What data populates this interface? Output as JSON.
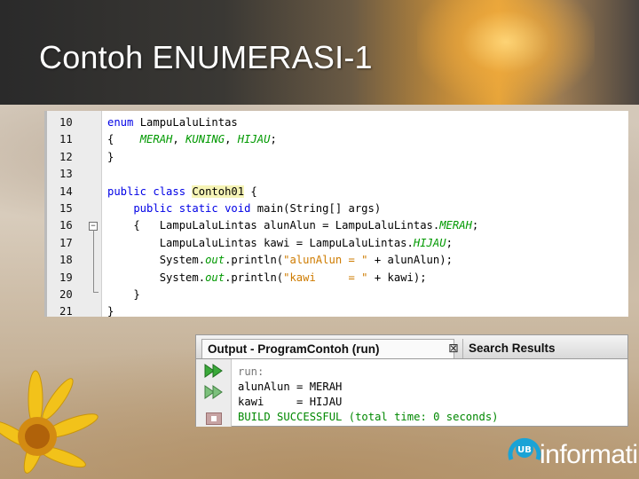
{
  "slide": {
    "title": "Contoh ENUMERASI-1"
  },
  "editor": {
    "lines": [
      {
        "num": "10",
        "parts": [
          [
            "kw",
            "enum "
          ],
          [
            "cl",
            "LampuLaluLintas"
          ]
        ]
      },
      {
        "num": "11",
        "parts": [
          [
            "cl",
            "{    "
          ],
          [
            "const",
            "MERAH"
          ],
          [
            "cl",
            ", "
          ],
          [
            "const",
            "KUNING"
          ],
          [
            "cl",
            ", "
          ],
          [
            "const",
            "HIJAU"
          ],
          [
            "cl",
            ";"
          ]
        ]
      },
      {
        "num": "12",
        "parts": [
          [
            "cl",
            "}"
          ]
        ]
      },
      {
        "num": "13",
        "parts": []
      },
      {
        "num": "14",
        "parts": [
          [
            "kw",
            "public class "
          ],
          [
            "hl",
            "Contoh01"
          ],
          [
            "cl",
            " {"
          ]
        ]
      },
      {
        "num": "15",
        "parts": [
          [
            "kw",
            "    public static void "
          ],
          [
            "cl",
            "main(String[] args)"
          ]
        ]
      },
      {
        "num": "16",
        "parts": [
          [
            "cl",
            "    {   LampuLaluLintas alunAlun = LampuLaluLintas."
          ],
          [
            "const",
            "MERAH"
          ],
          [
            "cl",
            ";"
          ]
        ]
      },
      {
        "num": "17",
        "parts": [
          [
            "cl",
            "        LampuLaluLintas kawi = LampuLaluLintas."
          ],
          [
            "const",
            "HIJAU"
          ],
          [
            "cl",
            ";"
          ]
        ]
      },
      {
        "num": "18",
        "parts": [
          [
            "cl",
            "        System."
          ],
          [
            "out",
            "out"
          ],
          [
            "cl",
            ".println("
          ],
          [
            "str",
            "\"alunAlun = \""
          ],
          [
            "cl",
            " + alunAlun);"
          ]
        ]
      },
      {
        "num": "19",
        "parts": [
          [
            "cl",
            "        System."
          ],
          [
            "out",
            "out"
          ],
          [
            "cl",
            ".println("
          ],
          [
            "str",
            "\"kawi     = \""
          ],
          [
            "cl",
            " + kawi);"
          ]
        ]
      },
      {
        "num": "20",
        "parts": [
          [
            "cl",
            "    }"
          ]
        ]
      },
      {
        "num": "21",
        "parts": [
          [
            "cl",
            "}"
          ]
        ]
      }
    ]
  },
  "output": {
    "tab_active": "Output - ProgramContoh (run)",
    "tab_close": "⊠",
    "tab_inactive": "Search Results",
    "lines": [
      "run:",
      "alunAlun = MERAH",
      "kawi     = HIJAU"
    ],
    "success_line": "BUILD SUCCESSFUL (total time: 0 seconds)"
  },
  "logo": {
    "text": "informatika",
    "mark": "UB"
  },
  "colors": {
    "keyword": "#0000e6",
    "constant": "#009900",
    "string": "#ce7b00",
    "highlight": "#f6f4b6"
  }
}
